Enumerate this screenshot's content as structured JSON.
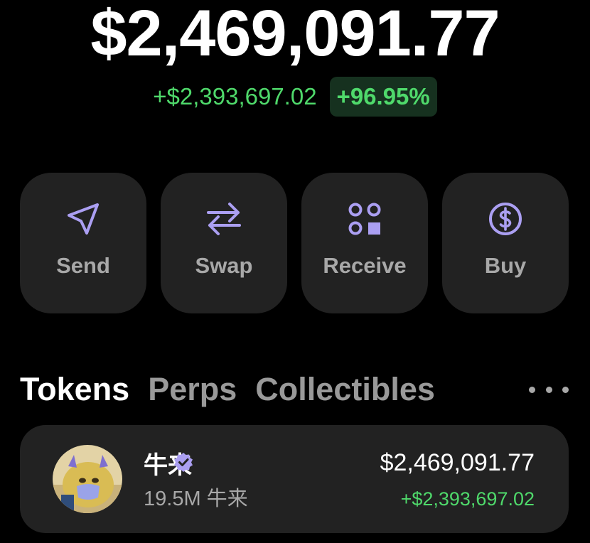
{
  "portfolio": {
    "balance": "$2,469,091.77",
    "change_amount": "+$2,393,697.02",
    "change_percent": "+96.95%"
  },
  "actions": [
    {
      "label": "Send",
      "icon": "send-icon"
    },
    {
      "label": "Swap",
      "icon": "swap-icon"
    },
    {
      "label": "Receive",
      "icon": "receive-icon"
    },
    {
      "label": "Buy",
      "icon": "buy-icon"
    }
  ],
  "tabs": [
    {
      "label": "Tokens",
      "active": true
    },
    {
      "label": "Perps",
      "active": false
    },
    {
      "label": "Collectibles",
      "active": false
    }
  ],
  "more_icon": "more-horizontal-icon",
  "tokens": [
    {
      "name": "牛来",
      "quantity": "19.5M 牛来",
      "value": "$2,469,091.77",
      "change": "+$2,393,697.02",
      "verified": true
    }
  ],
  "colors": {
    "accent": "#ab9ff2",
    "positive": "#4fd96b",
    "card_bg": "#222222",
    "background": "#000000",
    "muted_text": "#a8a8a8"
  }
}
